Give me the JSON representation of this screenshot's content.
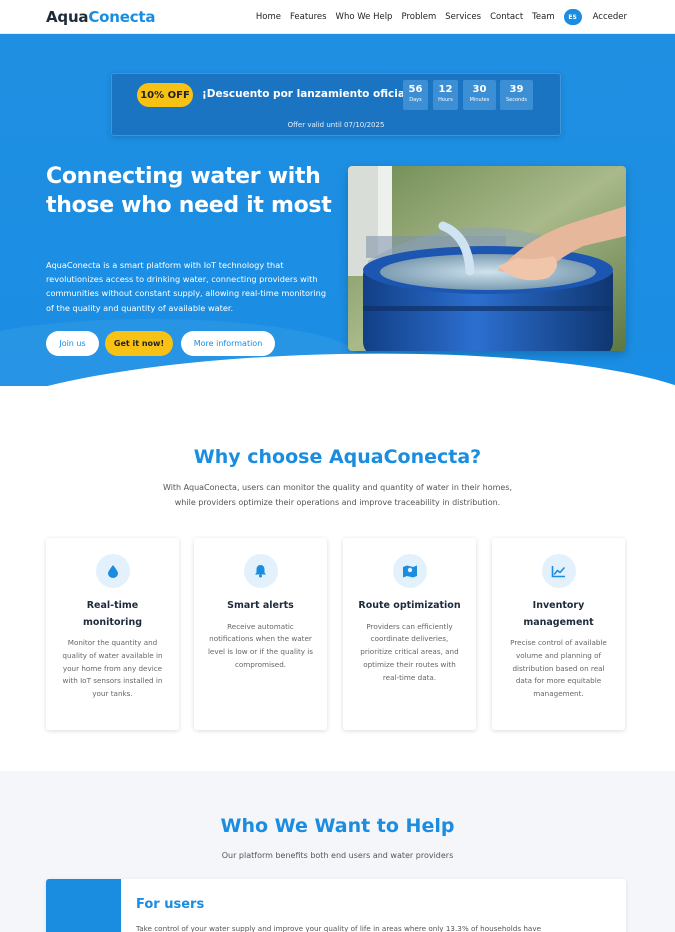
{
  "nav": {
    "logo_part1": "Aqua",
    "logo_part2": "Conecta",
    "items": [
      "Home",
      "Features",
      "Who We Help",
      "Problem",
      "Services",
      "Contact",
      "Team"
    ],
    "lang": "ES",
    "login": "Acceder"
  },
  "promo": {
    "badge": "10% OFF",
    "text": "¡Descuento por lanzamiento oficial!",
    "countdown": [
      {
        "value": "56",
        "label": "Days"
      },
      {
        "value": "12",
        "label": "Hours"
      },
      {
        "value": "30",
        "label": "Minutes"
      },
      {
        "value": "39",
        "label": "Seconds"
      }
    ],
    "valid": "Offer valid until 07/10/2025"
  },
  "hero": {
    "title": "Connecting water with those who need it most",
    "description": "AquaConecta is a smart platform with IoT technology that revolutionizes access to drinking water, connecting providers with communities without constant supply, allowing real-time monitoring of the quality and quantity of available water.",
    "join": "Join us",
    "get": "Get it now!",
    "more": "More information"
  },
  "why": {
    "title": "Why choose AquaConecta?",
    "subtitle": "With AquaConecta, users can monitor the quality and quantity of water in their homes, while providers optimize their operations and improve traceability in distribution.",
    "cards": [
      {
        "icon": "water-drop-icon",
        "title": "Real-time monitoring",
        "text": "Monitor the quantity and quality of water available in your home from any device with IoT sensors installed in your tanks."
      },
      {
        "icon": "bell-icon",
        "title": "Smart alerts",
        "text": "Receive automatic notifications when the water level is low or if the quality is compromised."
      },
      {
        "icon": "map-icon",
        "title": "Route optimization",
        "text": "Providers can efficiently coordinate deliveries, prioritize critical areas, and optimize their routes with real-time data."
      },
      {
        "icon": "chart-line-icon",
        "title": "Inventory management",
        "text": "Precise control of available volume and planning of distribution based on real data for more equitable management."
      }
    ]
  },
  "who": {
    "title": "Who We Want to Help",
    "subtitle": "Our platform benefits both end users and water providers",
    "card_title": "For users",
    "card_text": "Take control of your water supply and improve your quality of life in areas where only 13.3% of households have"
  },
  "colors": {
    "primary": "#1a8de0",
    "accent": "#f7c215",
    "dark": "#1d2b3a"
  }
}
